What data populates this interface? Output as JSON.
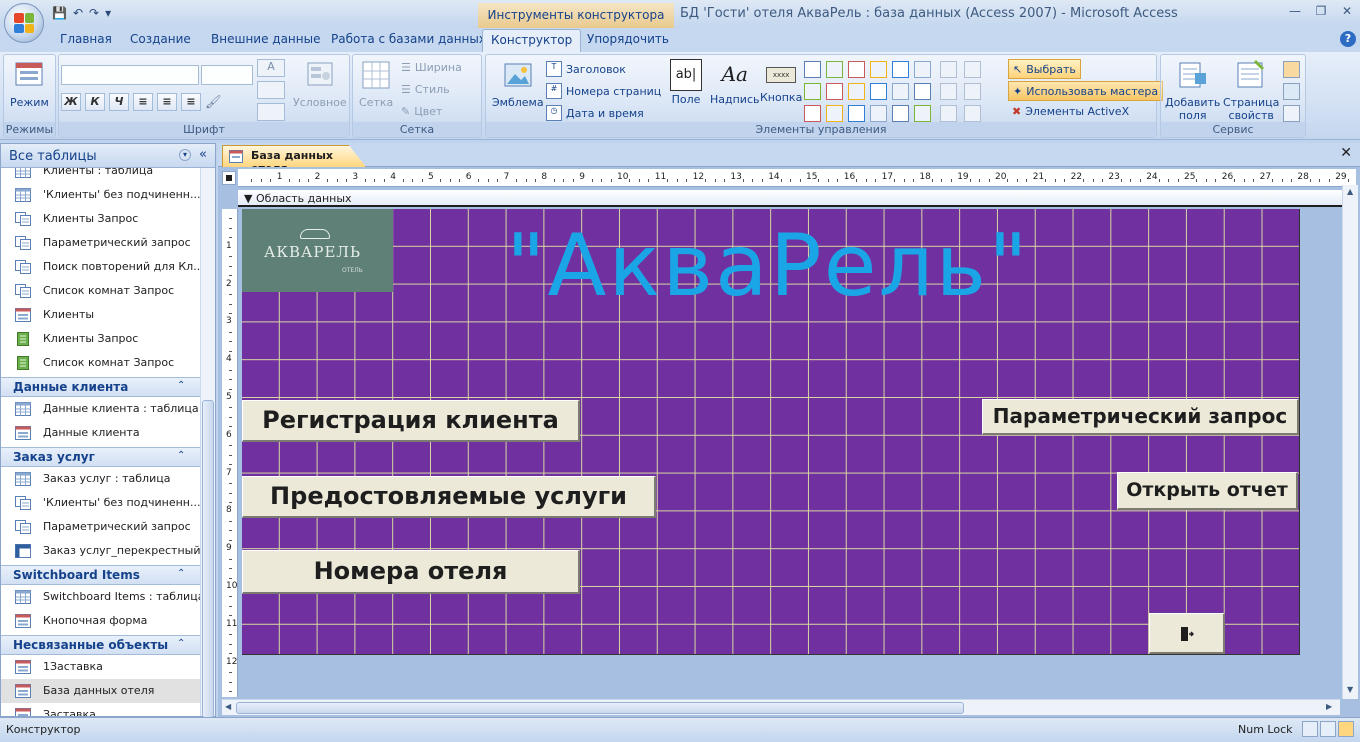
{
  "titlebar": {
    "contextual_tab_title": "Инструменты конструктора форм",
    "window_title": "БД 'Гости' отеля АкваРель : база данных (Access 2007) - Microsoft Access"
  },
  "ribbon_tabs": [
    "Главная",
    "Создание",
    "Внешние данные",
    "Работа с базами данных",
    "Конструктор",
    "Упорядочить"
  ],
  "ribbon": {
    "groups": {
      "modes": "Режимы",
      "font": "Шрифт",
      "grid": "Сетка",
      "controls": "Элементы управления",
      "tools": "Сервис"
    },
    "buttons": {
      "view": "Режим",
      "conditional": "Условное",
      "grid": "Сетка",
      "width": "Ширина",
      "style": "Стиль",
      "color": "Цвет",
      "logo": "Эмблема",
      "title": "Заголовок",
      "page_numbers": "Номера страниц",
      "date_time": "Дата и время",
      "field": "Поле",
      "label": "Надпись",
      "button": "Кнопка",
      "select": "Выбрать",
      "use_wizards": "Использовать мастера",
      "activex": "Элементы ActiveX",
      "add_fields_line1": "Добавить",
      "add_fields_line2": "поля",
      "property_sheet_line1": "Страница",
      "property_sheet_line2": "свойств"
    },
    "font_format_labels": [
      "Ж",
      "К",
      "Ч"
    ]
  },
  "nav": {
    "header": "Все таблицы",
    "items": [
      {
        "type": "item",
        "icon": "table-icon",
        "label": "Клиенты : таблица"
      },
      {
        "type": "item",
        "icon": "table-icon",
        "label": "'Клиенты' без подчиненн..."
      },
      {
        "type": "item",
        "icon": "query-icon",
        "label": "Клиенты Запрос"
      },
      {
        "type": "item",
        "icon": "query-icon",
        "label": "Параметрический запрос"
      },
      {
        "type": "item",
        "icon": "query-icon",
        "label": "Поиск повторений для Кл..."
      },
      {
        "type": "item",
        "icon": "query-icon",
        "label": "Список комнат Запрос"
      },
      {
        "type": "item",
        "icon": "form-icon",
        "label": "Клиенты"
      },
      {
        "type": "item",
        "icon": "report-icon",
        "label": "Клиенты Запрос"
      },
      {
        "type": "item",
        "icon": "report-icon",
        "label": "Список комнат Запрос"
      },
      {
        "type": "group",
        "label": "Данные клиента"
      },
      {
        "type": "item",
        "icon": "table-icon",
        "label": "Данные клиента : таблица"
      },
      {
        "type": "item",
        "icon": "form-icon",
        "label": "Данные клиента"
      },
      {
        "type": "group",
        "label": "Заказ услуг"
      },
      {
        "type": "item",
        "icon": "table-icon",
        "label": "Заказ услуг : таблица"
      },
      {
        "type": "item",
        "icon": "query-icon",
        "label": "'Клиенты' без подчиненн..."
      },
      {
        "type": "item",
        "icon": "query-icon",
        "label": "Параметрический запрос"
      },
      {
        "type": "item",
        "icon": "crosstab-icon",
        "label": "Заказ услуг_перекрестный"
      },
      {
        "type": "group",
        "label": "Switchboard Items"
      },
      {
        "type": "item",
        "icon": "table-icon",
        "label": "Switchboard Items : таблица"
      },
      {
        "type": "item",
        "icon": "form-icon",
        "label": "Кнопочная форма"
      },
      {
        "type": "group",
        "label": "Несвязанные объекты"
      },
      {
        "type": "item",
        "icon": "form-icon",
        "label": "1Заставка"
      },
      {
        "type": "item",
        "icon": "form-icon",
        "label": "База данных отеля",
        "selected": true
      },
      {
        "type": "item",
        "icon": "form-icon",
        "label": "Заставка"
      }
    ]
  },
  "document": {
    "tab_label": "База данных отеля",
    "section_label": "Область данных",
    "ruler_top": [
      "1",
      "2",
      "3",
      "4",
      "5",
      "6",
      "7",
      "8",
      "9",
      "10",
      "11",
      "12",
      "13",
      "14",
      "15",
      "16",
      "17",
      "18",
      "19",
      "20",
      "21",
      "22",
      "23",
      "24",
      "25",
      "26",
      "27",
      "28",
      "29"
    ],
    "ruler_left": [
      "1",
      "2",
      "3",
      "4",
      "5",
      "6",
      "7",
      "8",
      "9",
      "10",
      "11",
      "12"
    ]
  },
  "form": {
    "logo_text": "АКВАРЕЛЬ",
    "logo_subtext": "ОТЕЛЬ",
    "headline": "\"АкваРель\"",
    "buttons": {
      "register": "Регистрация клиента",
      "services": "Предостовляемые услуги",
      "rooms": "Номера отеля",
      "param_query": "Параметрический запрос",
      "open_report": "Открыть отчет"
    }
  },
  "statusbar": {
    "mode": "Конструктор",
    "numlock": "Num Lock"
  },
  "colors": {
    "form_background": "#7030a0",
    "headline": "#1aa6e6",
    "grid_lines": "#d8d8a0",
    "doc_tab": "#ffd67e"
  }
}
